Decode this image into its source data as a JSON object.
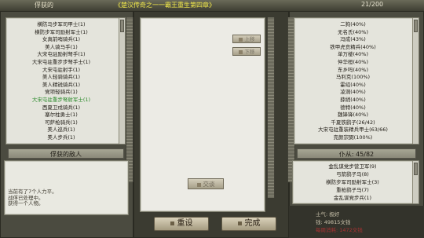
{
  "header": {
    "left_label": "俘获的",
    "title": "《楚汉传奇之一一霸王重生第四章》",
    "counter": "21/200"
  },
  "left": {
    "items": [
      "横防马步军司甲士(1)",
      "横防步军司励射军士(1)",
      "女真前哨骑兵(1)",
      "美人骑马手(1)",
      "大宋屯驻励射弩手(1)",
      "大宋屯驻重步步弩手士(1)",
      "大宋屯驻射手(1)",
      "美人轻骑骑兵(1)",
      "美人精锐骑兵(1)",
      "党项轻骑兵(1)",
      "大宋屯驻重步弩射军士(1)",
      "西夏卫戍骑兵(1)",
      "塞尔柱勇士(1)",
      "可萨枪骑兵(1)",
      "美人巡兵(1)",
      "美人步兵(1)"
    ],
    "selected_index": 10,
    "captive_header": "俘获的敌人",
    "log_lines": [
      "当前有了7个人力平。",
      "战俘已处理中。",
      "获得一个人物。"
    ]
  },
  "middle": {
    "up_label": "上移",
    "down_label": "下移",
    "talk_label": "交谈"
  },
  "right": {
    "items": [
      "二狗(40%)",
      "无名氏(40%)",
      "冯成(43%)",
      "铁甲虎贲精兵(40%)",
      "单万楼(40%)",
      "仲华桓(40%)",
      "东乡吗(40%)",
      "马利克(100%)",
      "霍绍(40%)",
      "凌洞(40%)",
      "薛绡(40%)",
      "德特(40%)",
      "魏锋锋(40%)",
      "千夏铁鹞子(26/42)",
      "大宋屯驻重装精兵甲士(63/66)",
      "完颜宗弼(100%)"
    ],
    "unit_count_label": "仆从: 45/82",
    "unit_items": [
      "金乱谋党步营卫军(9)",
      "弓箭鹞子马(8)",
      "横防步军司励射军士(3)",
      "重枪鹞子马(7)",
      "金乱谋党步兵(1)"
    ],
    "morale": "士气: 极好",
    "gold": "钱: 49815文钱",
    "food": "每周消耗: 1472文钱"
  },
  "footer": {
    "reset_label": "重设",
    "done_label": "完成"
  }
}
